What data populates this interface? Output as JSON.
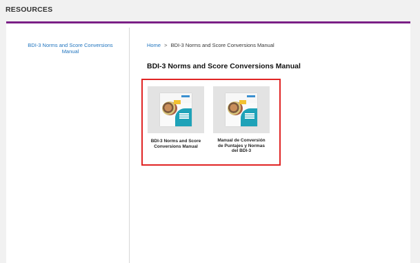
{
  "header": {
    "title": "RESOURCES"
  },
  "colors": {
    "accent_bar": "#7a1f86",
    "link": "#1e73be",
    "highlight_border": "#e02424",
    "cover_teal": "#1ea2b8"
  },
  "sidebar": {
    "items": [
      {
        "label": "BDI-3 Norms and Score Conversions Manual"
      }
    ]
  },
  "breadcrumb": {
    "home": "Home",
    "separator": ">",
    "current": "BDI-3 Norms and Score Conversions Manual"
  },
  "main": {
    "title": "BDI-3 Norms and Score Conversions Manual",
    "tiles": [
      {
        "caption": "BDI-3 Norms and Score Conversions Manual",
        "icon": "book-cover-thumbnail"
      },
      {
        "caption": "Manual de Conversión de Puntajes y Normas del BDI-3",
        "icon": "book-cover-thumbnail"
      }
    ]
  }
}
